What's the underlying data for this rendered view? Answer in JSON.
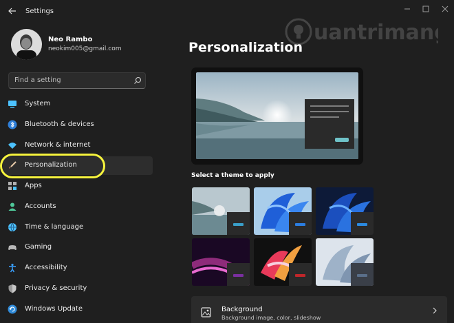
{
  "window": {
    "title": "Settings",
    "controls": [
      "minimize-icon",
      "maximize-icon",
      "close-icon"
    ]
  },
  "user": {
    "name": "Neo Rambo",
    "email": "neokim005@gmail.com"
  },
  "search": {
    "placeholder": "Find a setting",
    "icon": "search-icon"
  },
  "sidebar": {
    "items": [
      {
        "label": "System",
        "icon": "monitor-icon",
        "color": "#4cc2ff"
      },
      {
        "label": "Bluetooth & devices",
        "icon": "bluetooth-icon",
        "color": "#4cc2ff"
      },
      {
        "label": "Network & internet",
        "icon": "wifi-icon",
        "color": "#4cc2ff"
      },
      {
        "label": "Personalization",
        "icon": "brush-icon",
        "color": "#f0a070",
        "active": true
      },
      {
        "label": "Apps",
        "icon": "apps-icon",
        "color": "#a0a0a0"
      },
      {
        "label": "Accounts",
        "icon": "person-icon",
        "color": "#4fc99a"
      },
      {
        "label": "Time & language",
        "icon": "globe-icon",
        "color": "#4cc2ff"
      },
      {
        "label": "Gaming",
        "icon": "controller-icon",
        "color": "#a0a0a0"
      },
      {
        "label": "Accessibility",
        "icon": "accessibility-icon",
        "color": "#3aa0ff"
      },
      {
        "label": "Privacy & security",
        "icon": "shield-icon",
        "color": "#a0a0a0"
      },
      {
        "label": "Windows Update",
        "icon": "update-icon",
        "color": "#4cc2ff"
      }
    ],
    "highlight_color": "#f7f43d"
  },
  "main": {
    "title": "Personalization",
    "watermark_text": "uantrimang",
    "themes_label": "Select a theme to apply",
    "themes": [
      {
        "name": "landscape-light",
        "accent": "#3a9fc9"
      },
      {
        "name": "bloom-light",
        "accent": "#2b7de0"
      },
      {
        "name": "bloom-dark",
        "accent": "#2b8ae0"
      },
      {
        "name": "glow",
        "accent": "#7a2fa0"
      },
      {
        "name": "captured-motion",
        "accent": "#c0262a"
      },
      {
        "name": "flow",
        "accent": "#5a6f8a"
      }
    ],
    "background_row": {
      "title": "Background",
      "subtitle": "Background image, color, slideshow",
      "icon": "image-icon",
      "chevron": "chevron-right-icon"
    }
  },
  "colors": {
    "window_bg": "#1f1f1f",
    "accent": "#4cc2ff"
  }
}
